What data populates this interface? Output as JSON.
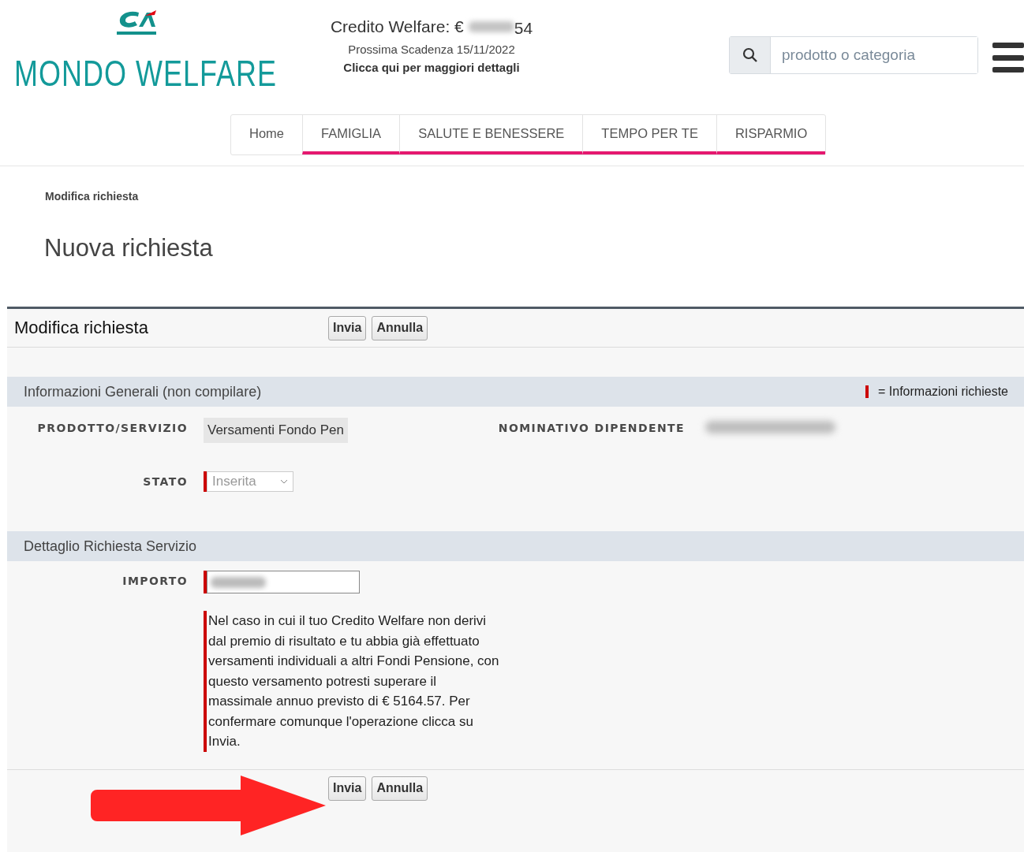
{
  "header": {
    "brand": "MONDO WELFARE",
    "credit_label": "Credito Welfare: €",
    "credit_visible_end": "54",
    "deadline": "Prossima Scadenza 15/11/2022",
    "details_link": "Clicca qui per maggiori dettagli",
    "search": {
      "placeholder": "prodotto o categoria"
    }
  },
  "nav": [
    {
      "label": "Home",
      "highlighted": false
    },
    {
      "label": "FAMIGLIA",
      "highlighted": true
    },
    {
      "label": "SALUTE E BENESSERE",
      "highlighted": true
    },
    {
      "label": "TEMPO PER TE",
      "highlighted": true
    },
    {
      "label": "RISPARMIO",
      "highlighted": true
    }
  ],
  "breadcrumb": "Modifica richiesta",
  "page_title": "Nuova richiesta",
  "form": {
    "title": "Modifica richiesta",
    "top_buttons": [
      "Invia",
      "Annulla"
    ],
    "sections": [
      {
        "title": "Informazioni Generali (non compilare)",
        "legend": "= Informazioni richieste",
        "fields": [
          {
            "kind": "readonly",
            "label": "PRODOTTO/SERVIZIO",
            "value": "Versamenti Fondo Pen"
          },
          {
            "kind": "redacted",
            "label": "NOMINATIVO DIPENDENTE"
          },
          {
            "kind": "select",
            "label": "STATO",
            "value": "Inserita",
            "required": true,
            "disabled": true
          }
        ]
      },
      {
        "title": "Dettaglio Richiesta Servizio",
        "fields": [
          {
            "kind": "redacted-input",
            "label": "IMPORTO",
            "required": true
          },
          {
            "kind": "note",
            "text": "Nel caso in cui il tuo Credito Welfare non derivi dal premio di risultato e tu abbia già effettuato versamenti individuali a altri Fondi Pensione, con questo versamento potresti superare il massimale annuo previsto di € 5164.57. Per confermare comunque l'operazione clicca su Invia.",
            "required": true
          }
        ]
      }
    ],
    "bottom_buttons": [
      "Invia",
      "Annulla"
    ]
  }
}
